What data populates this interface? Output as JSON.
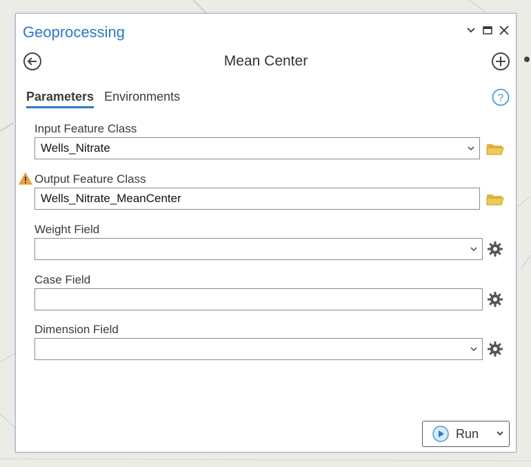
{
  "pane": {
    "title": "Geoprocessing"
  },
  "tool": {
    "title": "Mean Center"
  },
  "tabs": [
    {
      "label": "Parameters",
      "active": true
    },
    {
      "label": "Environments",
      "active": false
    }
  ],
  "parameters": [
    {
      "label": "Input Feature Class",
      "value": "Wells_Nitrate",
      "control": "dropdown",
      "side_icon": "folder-icon"
    },
    {
      "label": "Output Feature Class",
      "value": "Wells_Nitrate_MeanCenter",
      "control": "text",
      "side_icon": "folder-icon",
      "warning": true
    },
    {
      "label": "Weight Field",
      "value": "",
      "control": "dropdown",
      "side_icon": "gear-icon"
    },
    {
      "label": "Case Field",
      "value": "",
      "control": "text",
      "side_icon": "gear-icon"
    },
    {
      "label": "Dimension Field",
      "value": "",
      "control": "dropdown",
      "side_icon": "gear-icon"
    }
  ],
  "run_button": {
    "label": "Run"
  },
  "icons": {
    "window": [
      "chevron-down-icon",
      "maximize-icon",
      "close-icon"
    ],
    "navigation": [
      "back-arrow-icon",
      "add-icon",
      "help-icon",
      "warning-icon",
      "play-icon"
    ]
  },
  "colors": {
    "accent": "#2b79c2",
    "folder": "#e0b63c",
    "warning": "#f2a33a",
    "gear": "#555555"
  }
}
